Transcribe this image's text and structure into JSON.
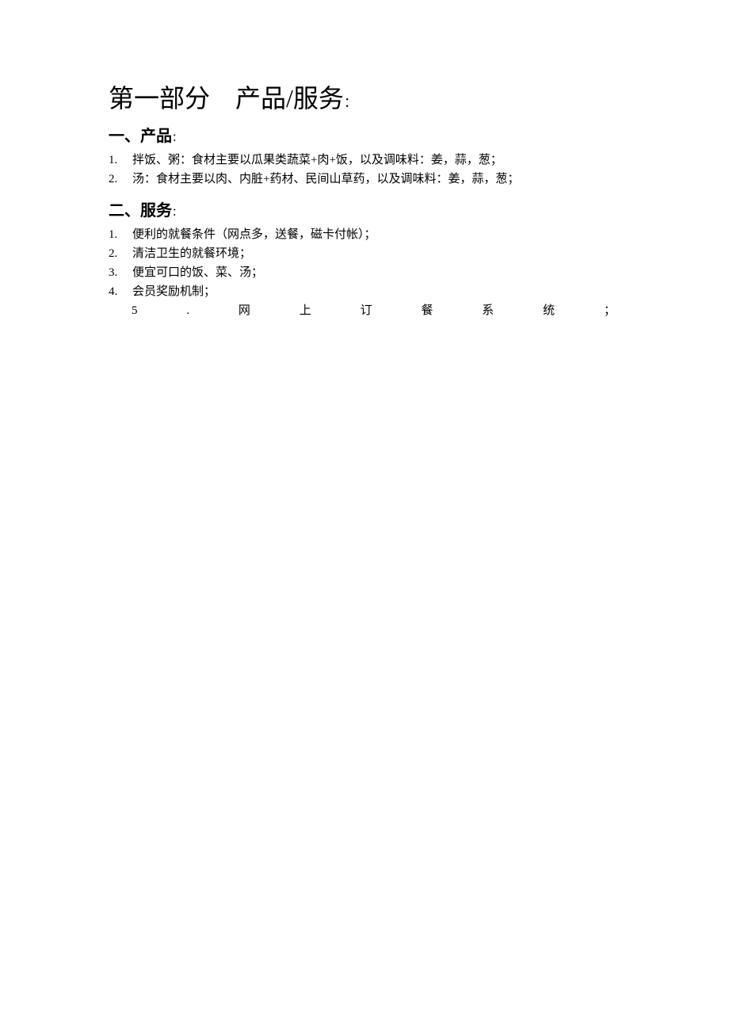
{
  "document": {
    "title": {
      "part_label": "第一部分",
      "subject": "产品/服务",
      "colon": "："
    },
    "sections": [
      {
        "id": "products",
        "heading": "一、产品",
        "heading_colon": "：",
        "items": [
          {
            "marker": "1.",
            "text": "拌饭、粥：食材主要以瓜果类蔬菜+肉+饭，以及调味料：姜，蒜，葱；"
          },
          {
            "marker": "2.",
            "text": "汤：食材主要以肉、内脏+药材、民间山草药，以及调味料：姜，蒜，葱；"
          }
        ]
      },
      {
        "id": "services",
        "heading": "二、服务",
        "heading_colon": "：",
        "items": [
          {
            "marker": "1.",
            "text": "便利的就餐条件（网点多，送餐，磁卡付帐）；"
          },
          {
            "marker": "2.",
            "text": "清洁卫生的就餐环境；"
          },
          {
            "marker": "3.",
            "text": "便宜可口的饭、菜、汤；"
          },
          {
            "marker": "4.",
            "text": "会员奖励机制；"
          }
        ],
        "justified_item": {
          "glyphs": [
            "5",
            ".",
            "网",
            "上",
            "订",
            "餐",
            "系",
            "统",
            "；"
          ]
        }
      }
    ]
  },
  "colors": {
    "page_background": "#ffffff",
    "text": "#000000"
  }
}
